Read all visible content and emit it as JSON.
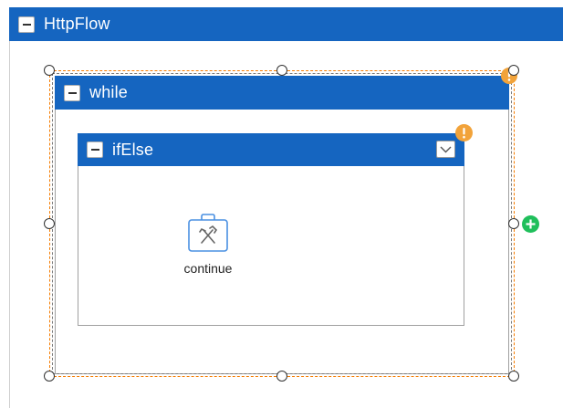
{
  "flow": {
    "title": "HttpFlow",
    "collapse_icon": "minus-icon"
  },
  "while_block": {
    "title": "while",
    "collapse_icon": "minus-icon",
    "warning_icon": "warning-icon",
    "add_icon": "plus-circle-icon"
  },
  "ifelse_block": {
    "title": "ifElse",
    "collapse_icon": "minus-icon",
    "warning_icon": "warning-icon",
    "expand_icon": "chevron-down-icon"
  },
  "continue_node": {
    "label": "continue",
    "icon": "toolbox-icon"
  },
  "colors": {
    "header_blue": "#1565c0",
    "selection_orange": "#f57c00",
    "warning_orange": "#f2a33a",
    "add_green": "#1fbf5b",
    "icon_blue": "#4a90e2"
  }
}
